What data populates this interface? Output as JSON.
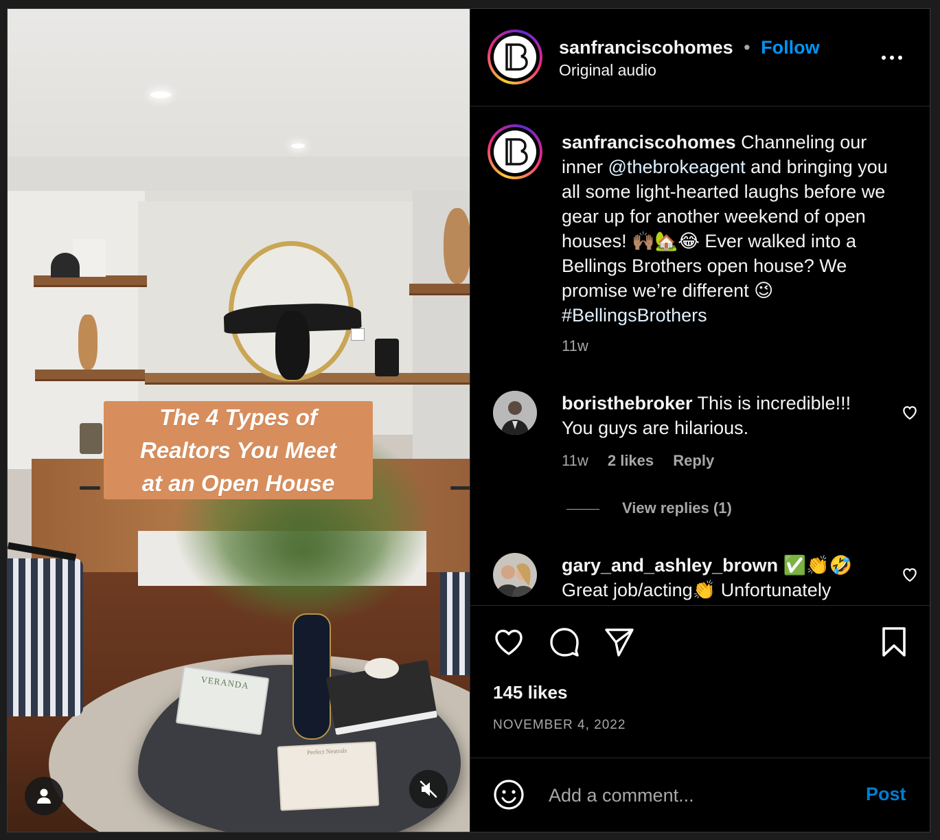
{
  "media": {
    "overlay_title": "The 4 Types of\nRealtors You Meet\nat an Open House",
    "book_title": "VERANDA",
    "book_title_2": "Perfect Neutrals",
    "user_icon": "user-icon",
    "mute_icon": "speaker-muted-icon"
  },
  "header": {
    "username": "sanfranciscohomes",
    "dot": "•",
    "follow_label": "Follow",
    "audio_label": "Original audio",
    "more_icon": "more-horizontal-icon",
    "avatar_letter": "B"
  },
  "caption": {
    "username": "sanfranciscohomes",
    "text_1": " Channeling our inner ",
    "mention": "@thebrokeagent",
    "text_2": " and bringing you all some light-hearted laughs before we gear up for another weekend of open houses! 🙌🏽🏡😂 Ever walked into a Bellings Brothers open house? We promise we’re different 😉 ",
    "hashtag": "#BellingsBrothers",
    "time": "11w"
  },
  "comments": [
    {
      "username": "boristhebroker",
      "text": " This is incredible!!! You guys are hilarious.",
      "time": "11w",
      "likes": "2 likes",
      "reply_label": "Reply",
      "view_replies": "View replies (1)"
    },
    {
      "username": "gary_and_ashley_brown",
      "emojis": " ✅👏🤣",
      "text": "Great job/acting👏 Unfortunately"
    }
  ],
  "actions": {
    "like_icon": "heart-icon",
    "comment_icon": "comment-icon",
    "share_icon": "send-icon",
    "save_icon": "bookmark-icon",
    "likes": "145 likes",
    "date": "NOVEMBER 4, 2022"
  },
  "composer": {
    "emoji_icon": "smiley-icon",
    "placeholder": "Add a comment...",
    "post_label": "Post"
  },
  "colors": {
    "background": "#000000",
    "accent": "#0095f6",
    "overlay": "#d88e5c"
  }
}
